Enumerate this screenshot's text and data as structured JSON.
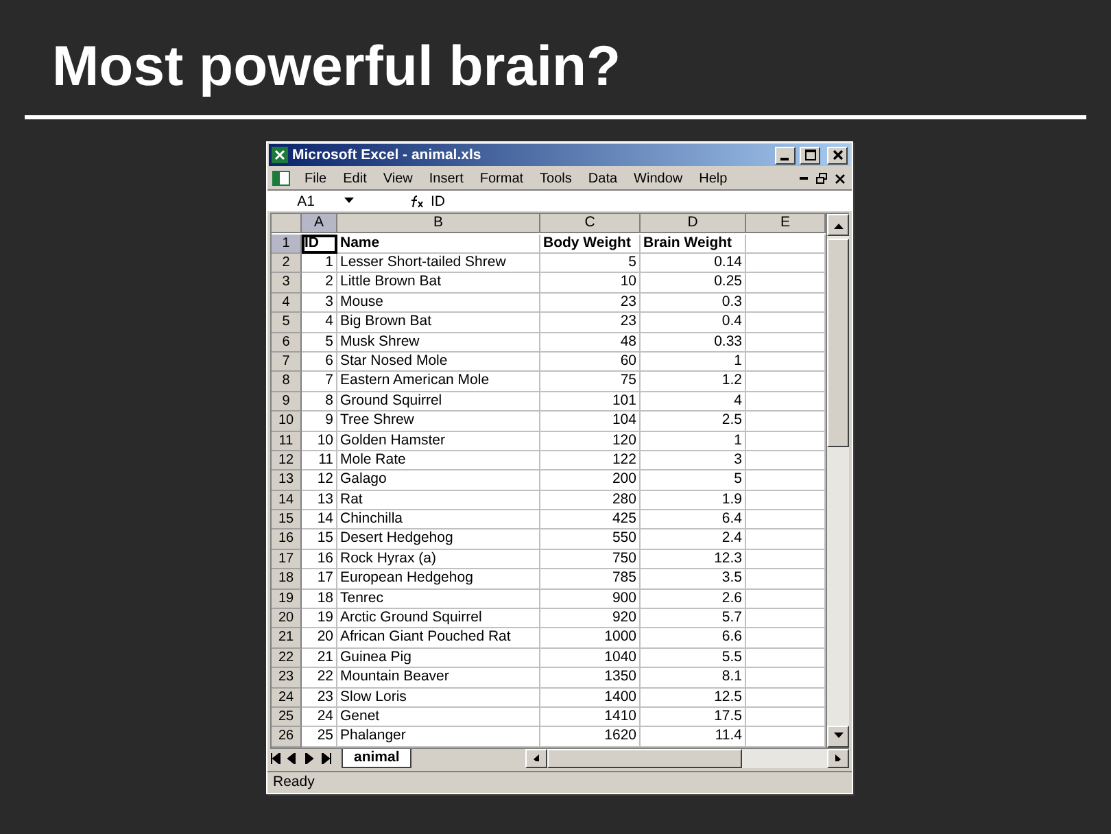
{
  "slide_title": "Most powerful brain?",
  "window": {
    "title": "Microsoft Excel - animal.xls"
  },
  "menu": [
    "File",
    "Edit",
    "View",
    "Insert",
    "Format",
    "Tools",
    "Data",
    "Window",
    "Help"
  ],
  "name_box": "A1",
  "formula": "ID",
  "columns": [
    {
      "label": "A",
      "selected": true
    },
    {
      "label": "B",
      "selected": false
    },
    {
      "label": "C",
      "selected": false
    },
    {
      "label": "D",
      "selected": false
    },
    {
      "label": "E",
      "selected": false
    }
  ],
  "rows": [
    {
      "number": "1",
      "selected": true,
      "kind": "header",
      "cells": [
        "ID",
        "Name",
        "Body Weight",
        "Brain Weight"
      ]
    },
    {
      "number": "2",
      "selected": false,
      "kind": "data",
      "cells": [
        "1",
        "Lesser Short-tailed Shrew",
        "5",
        "0.14"
      ]
    },
    {
      "number": "3",
      "selected": false,
      "kind": "data",
      "cells": [
        "2",
        "Little Brown Bat",
        "10",
        "0.25"
      ]
    },
    {
      "number": "4",
      "selected": false,
      "kind": "data",
      "cells": [
        "3",
        "Mouse",
        "23",
        "0.3"
      ]
    },
    {
      "number": "5",
      "selected": false,
      "kind": "data",
      "cells": [
        "4",
        "Big Brown Bat",
        "23",
        "0.4"
      ]
    },
    {
      "number": "6",
      "selected": false,
      "kind": "data",
      "cells": [
        "5",
        "Musk Shrew",
        "48",
        "0.33"
      ]
    },
    {
      "number": "7",
      "selected": false,
      "kind": "data",
      "cells": [
        "6",
        "Star Nosed Mole",
        "60",
        "1"
      ]
    },
    {
      "number": "8",
      "selected": false,
      "kind": "data",
      "cells": [
        "7",
        "Eastern American Mole",
        "75",
        "1.2"
      ]
    },
    {
      "number": "9",
      "selected": false,
      "kind": "data",
      "cells": [
        "8",
        "Ground Squirrel",
        "101",
        "4"
      ]
    },
    {
      "number": "10",
      "selected": false,
      "kind": "data",
      "cells": [
        "9",
        "Tree Shrew",
        "104",
        "2.5"
      ]
    },
    {
      "number": "11",
      "selected": false,
      "kind": "data",
      "cells": [
        "10",
        "Golden Hamster",
        "120",
        "1"
      ]
    },
    {
      "number": "12",
      "selected": false,
      "kind": "data",
      "cells": [
        "11",
        "Mole Rate",
        "122",
        "3"
      ]
    },
    {
      "number": "13",
      "selected": false,
      "kind": "data",
      "cells": [
        "12",
        "Galago",
        "200",
        "5"
      ]
    },
    {
      "number": "14",
      "selected": false,
      "kind": "data",
      "cells": [
        "13",
        "Rat",
        "280",
        "1.9"
      ]
    },
    {
      "number": "15",
      "selected": false,
      "kind": "data",
      "cells": [
        "14",
        "Chinchilla",
        "425",
        "6.4"
      ]
    },
    {
      "number": "16",
      "selected": false,
      "kind": "data",
      "cells": [
        "15",
        "Desert Hedgehog",
        "550",
        "2.4"
      ]
    },
    {
      "number": "17",
      "selected": false,
      "kind": "data",
      "cells": [
        "16",
        "Rock Hyrax (a)",
        "750",
        "12.3"
      ]
    },
    {
      "number": "18",
      "selected": false,
      "kind": "data",
      "cells": [
        "17",
        "European Hedgehog",
        "785",
        "3.5"
      ]
    },
    {
      "number": "19",
      "selected": false,
      "kind": "data",
      "cells": [
        "18",
        "Tenrec",
        "900",
        "2.6"
      ]
    },
    {
      "number": "20",
      "selected": false,
      "kind": "data",
      "cells": [
        "19",
        "Arctic Ground Squirrel",
        "920",
        "5.7"
      ]
    },
    {
      "number": "21",
      "selected": false,
      "kind": "data",
      "cells": [
        "20",
        "African Giant Pouched Rat",
        "1000",
        "6.6"
      ]
    },
    {
      "number": "22",
      "selected": false,
      "kind": "data",
      "cells": [
        "21",
        "Guinea Pig",
        "1040",
        "5.5"
      ]
    },
    {
      "number": "23",
      "selected": false,
      "kind": "data",
      "cells": [
        "22",
        "Mountain Beaver",
        "1350",
        "8.1"
      ]
    },
    {
      "number": "24",
      "selected": false,
      "kind": "data",
      "cells": [
        "23",
        "Slow Loris",
        "1400",
        "12.5"
      ]
    },
    {
      "number": "25",
      "selected": false,
      "kind": "data",
      "cells": [
        "24",
        "Genet",
        "1410",
        "17.5"
      ]
    },
    {
      "number": "26",
      "selected": false,
      "kind": "data",
      "cells": [
        "25",
        "Phalanger",
        "1620",
        "11.4"
      ]
    }
  ],
  "sheet_tabs": [
    {
      "label": "animal",
      "selected": true
    }
  ],
  "status": "Ready"
}
